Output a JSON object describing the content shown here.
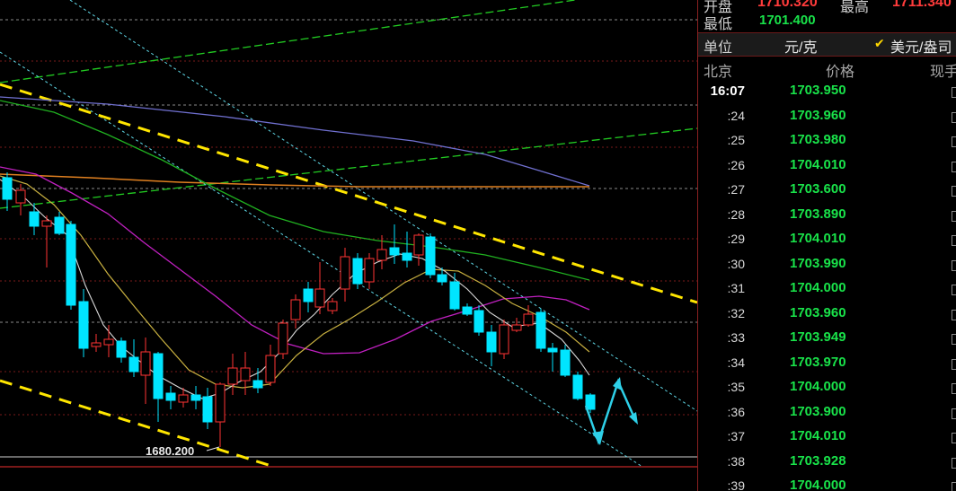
{
  "chart": {
    "low_marker_label": "1680.200",
    "low_marker_price": 1680.2
  },
  "quote_panel": {
    "top_row": {
      "open_label": "开盘",
      "open_value": "1710.320",
      "high_label": "最高",
      "high_value": "1711.340"
    },
    "low_row": {
      "label": "最低",
      "value": "1701.400"
    },
    "unit_row": {
      "label": "单位",
      "unit_value": "元/克",
      "checkmark_icon": "check-icon",
      "alt_unit": "美元/盎司"
    },
    "ticks_header": {
      "time": "北京",
      "price": "价格",
      "volume": "现手"
    },
    "ticks": [
      {
        "time": "16:07",
        "price": "1703.950"
      },
      {
        "time": ":24",
        "price": "1703.960"
      },
      {
        "time": ":25",
        "price": "1703.980"
      },
      {
        "time": ":26",
        "price": "1704.010"
      },
      {
        "time": ":27",
        "price": "1703.600"
      },
      {
        "time": ":28",
        "price": "1703.890"
      },
      {
        "time": ":29",
        "price": "1704.010"
      },
      {
        "time": ":30",
        "price": "1703.990"
      },
      {
        "time": ":31",
        "price": "1704.000"
      },
      {
        "time": ":32",
        "price": "1703.960"
      },
      {
        "time": ":33",
        "price": "1703.949"
      },
      {
        "time": ":34",
        "price": "1703.970"
      },
      {
        "time": ":35",
        "price": "1704.000"
      },
      {
        "time": ":36",
        "price": "1703.900"
      },
      {
        "time": ":37",
        "price": "1704.010"
      },
      {
        "time": ":38",
        "price": "1703.928"
      },
      {
        "time": ":39",
        "price": "1704.000"
      }
    ]
  },
  "colors": {
    "up_candle": "#ff3333",
    "down_candle": "#00e5ff",
    "price_green": "#19e34a",
    "price_red": "#ff3b3b",
    "trend_yellow": "#ffe600",
    "channel_cyan": "#5fd7e6",
    "ma_white": "#d9d9d9",
    "ma_yellow": "#c8b040",
    "ma_magenta": "#c020c0",
    "ma_green": "#20b020",
    "ma_blue": "#7070d0",
    "ma_orange": "#e08020"
  }
}
